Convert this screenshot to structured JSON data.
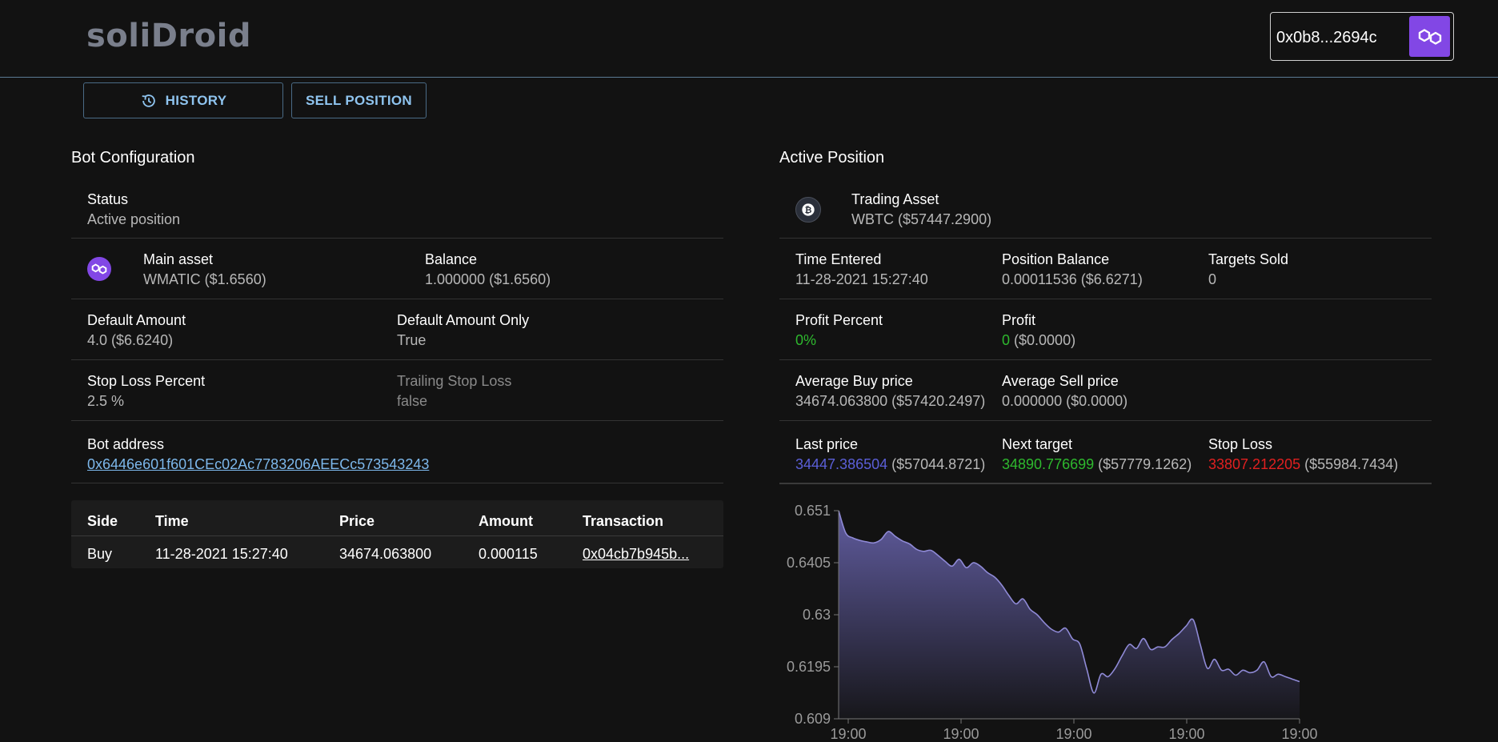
{
  "app": {
    "logo": "soliDroid",
    "wallet_address": "0x0b8...2694c",
    "network_icon": "polygon-icon"
  },
  "toolbar": {
    "history_label": "HISTORY",
    "history_icon": "history-icon",
    "sell_label": "SELL POSITION"
  },
  "bot_config": {
    "title": "Bot Configuration",
    "status": {
      "label": "Status",
      "value": "Active position"
    },
    "main_asset": {
      "label": "Main asset",
      "value": "WMATIC ($1.6560)",
      "icon": "polygon-icon"
    },
    "balance": {
      "label": "Balance",
      "value": "1.000000 ($1.6560)"
    },
    "default_amount": {
      "label": "Default Amount",
      "value": "4.0 ($6.6240)"
    },
    "default_amount_only": {
      "label": "Default Amount Only",
      "value": "True"
    },
    "stop_loss_percent": {
      "label": "Stop Loss Percent",
      "value": "2.5 %"
    },
    "trailing_stop_loss": {
      "label": "Trailing Stop Loss",
      "value": "false"
    },
    "bot_address": {
      "label": "Bot address",
      "value": "0x6446e601f601CEc02Ac7783206AEECc573543243"
    }
  },
  "trades": {
    "headers": [
      "Side",
      "Time",
      "Price",
      "Amount",
      "Transaction"
    ],
    "rows": [
      [
        "Buy",
        "11-28-2021 15:27:40",
        "34674.063800",
        "0.000115",
        "0x04cb7b945b..."
      ]
    ]
  },
  "position": {
    "title": "Active Position",
    "trading_asset": {
      "label": "Trading Asset",
      "value": "WBTC ($57447.2900)",
      "icon": "bitcoin-icon"
    },
    "time_entered": {
      "label": "Time Entered",
      "value": "11-28-2021 15:27:40"
    },
    "position_balance": {
      "label": "Position Balance",
      "value": "0.00011536 ($6.6271)"
    },
    "targets_sold": {
      "label": "Targets Sold",
      "value": "0"
    },
    "profit_percent": {
      "label": "Profit Percent",
      "value": "0%"
    },
    "profit": {
      "label": "Profit",
      "value": "0",
      "usd": " ($0.0000)"
    },
    "avg_buy": {
      "label": "Average Buy price",
      "value": "34674.063800 ($57420.2497)"
    },
    "avg_sell": {
      "label": "Average Sell price",
      "value": "0.000000 ($0.0000)"
    },
    "last_price": {
      "label": "Last price",
      "value": "34447.386504",
      "usd": " ($57044.8721)"
    },
    "next_target": {
      "label": "Next target",
      "value": "34890.776699",
      "usd": " ($57779.1262)"
    },
    "stop_loss": {
      "label": "Stop Loss",
      "value": "33807.212205",
      "usd": " ($55984.7434)"
    }
  },
  "colors": {
    "accent_link": "#7db8ec",
    "profit_green": "#2eb82e",
    "stop_red": "#e02020",
    "last_blue": "#5b5fd8",
    "chart_line": "#8f8ad6",
    "polygon_purple": "#8247e5"
  },
  "chart_data": {
    "type": "area",
    "ylim": [
      0.609,
      0.651
    ],
    "yticks": [
      "0.651",
      "0.6405",
      "0.63",
      "0.6195",
      "0.609"
    ],
    "xticks": [
      "19:00",
      "19:00",
      "19:00",
      "19:00",
      "19:00"
    ],
    "grid": false,
    "values": [
      0.651,
      0.6465,
      0.6455,
      0.645,
      0.6447,
      0.6445,
      0.6452,
      0.6468,
      0.6458,
      0.6449,
      0.6443,
      0.6432,
      0.6428,
      0.643,
      0.642,
      0.6408,
      0.6398,
      0.6412,
      0.6395,
      0.6405,
      0.6398,
      0.6385,
      0.6376,
      0.636,
      0.6339,
      0.6322,
      0.6332,
      0.6311,
      0.63,
      0.6284,
      0.6271,
      0.6265,
      0.6273,
      0.6251,
      0.6241,
      0.619,
      0.6142,
      0.618,
      0.6175,
      0.6192,
      0.6218,
      0.624,
      0.6232,
      0.6252,
      0.623,
      0.6235,
      0.6235,
      0.625,
      0.6262,
      0.6277,
      0.629,
      0.624,
      0.6192,
      0.621,
      0.6188,
      0.619,
      0.6178,
      0.6188,
      0.6183,
      0.6188,
      0.6205,
      0.6175,
      0.618,
      0.6175,
      0.617,
      0.6165
    ]
  }
}
